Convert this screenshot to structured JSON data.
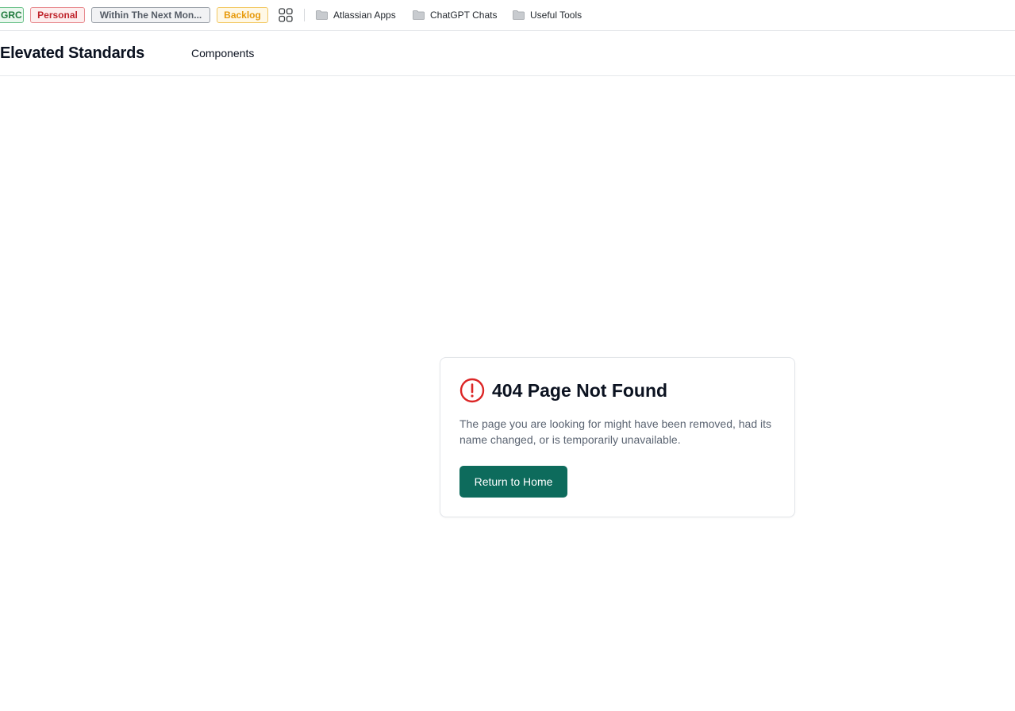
{
  "bookmarks_bar": {
    "tags": [
      {
        "label": "GRC",
        "color": "#1e7a3c"
      },
      {
        "label": "Personal",
        "color": "#c0262d"
      },
      {
        "label": "Within The Next Mon...",
        "color": "#555c66"
      },
      {
        "label": "Backlog",
        "color": "#e79a0c"
      }
    ],
    "apps_icon": "grid-apps-icon",
    "folders": [
      {
        "label": "Atlassian Apps",
        "icon": "folder-icon"
      },
      {
        "label": "ChatGPT Chats",
        "icon": "folder-icon"
      },
      {
        "label": "Useful Tools",
        "icon": "folder-icon"
      }
    ]
  },
  "header": {
    "brand": "Elevated Standards",
    "nav": [
      {
        "label": "Components"
      }
    ]
  },
  "error_card": {
    "icon": "alert-circle-icon",
    "icon_color": "#dc2626",
    "title": "404 Page Not Found",
    "description": "The page you are looking for might have been removed, had its name changed, or is temporarily unavailable.",
    "button_label": "Return to Home",
    "button_color": "#0d6b5c"
  }
}
